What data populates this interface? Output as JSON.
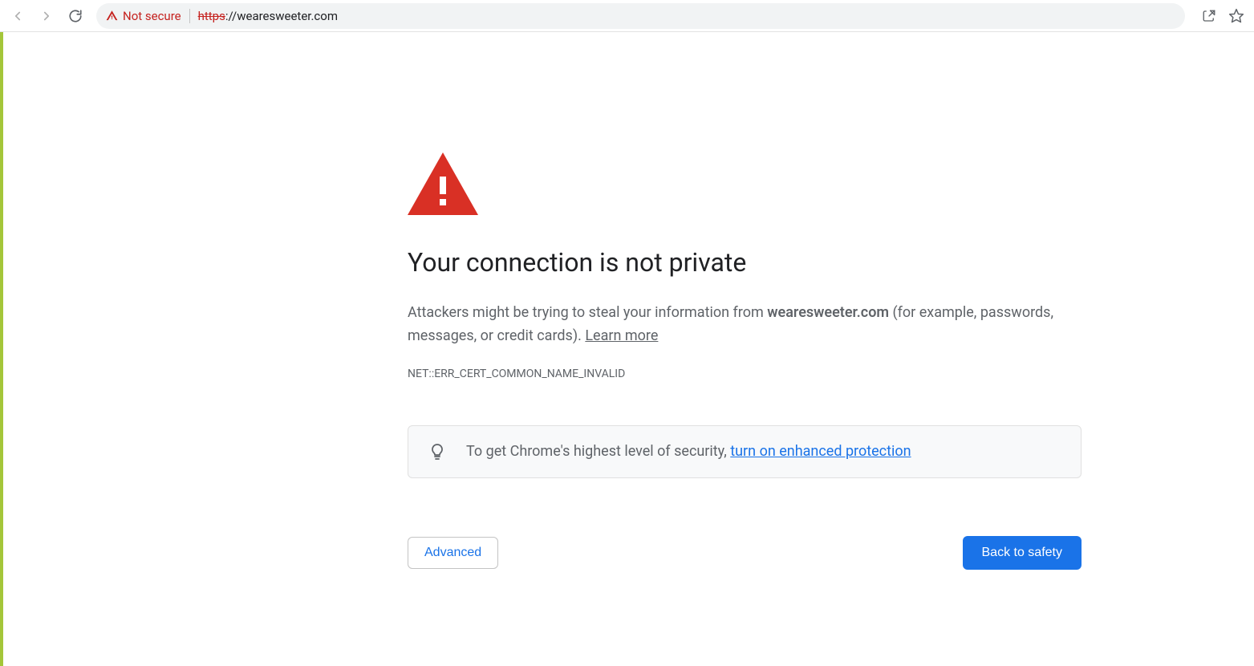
{
  "toolbar": {
    "security_label": "Not secure",
    "url_scheme": "https",
    "url_rest": "://wearesweeter.com"
  },
  "page": {
    "headline": "Your connection is not private",
    "body_prefix": "Attackers might be trying to steal your information from ",
    "body_domain": "wearesweeter.com",
    "body_suffix": " (for example, passwords, messages, or credit cards). ",
    "learn_more": "Learn more",
    "error_code": "NET::ERR_CERT_COMMON_NAME_INVALID",
    "tip_prefix": "To get Chrome's highest level of security, ",
    "tip_link": "turn on enhanced protection",
    "advanced_label": "Advanced",
    "safety_label": "Back to safety"
  }
}
